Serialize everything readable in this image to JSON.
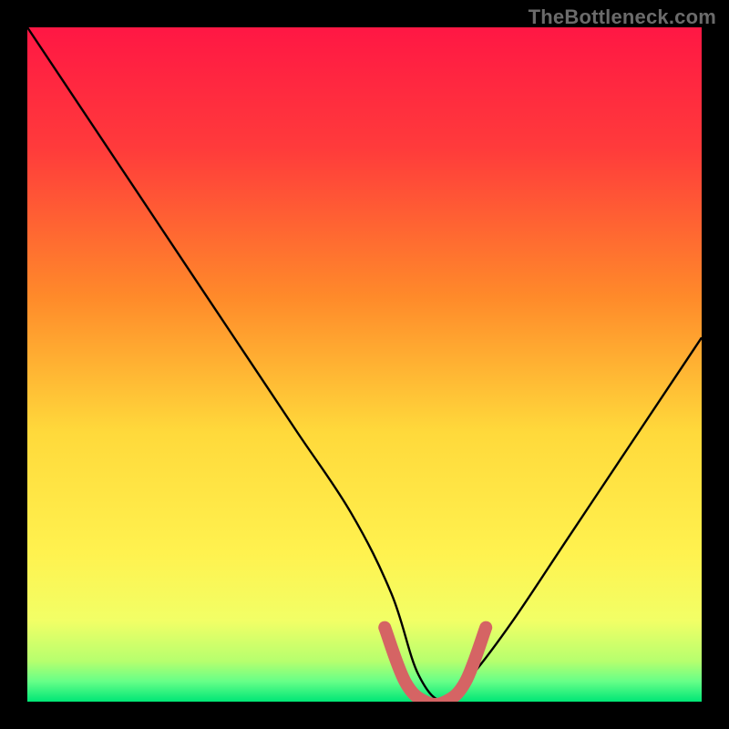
{
  "watermark": "TheBottleneck.com",
  "chart_data": {
    "type": "line",
    "title": "",
    "xlabel": "",
    "ylabel": "",
    "xlim": [
      0,
      100
    ],
    "ylim": [
      0,
      100
    ],
    "grid": false,
    "legend": false,
    "annotations": [],
    "series": [
      {
        "name": "bottleneck-curve",
        "x": [
          0,
          8,
          16,
          24,
          32,
          40,
          48,
          54,
          58,
          62,
          66,
          72,
          80,
          88,
          96,
          100
        ],
        "y": [
          100,
          88,
          76,
          64,
          52,
          40,
          28,
          16,
          4,
          0,
          4,
          12,
          24,
          36,
          48,
          54
        ]
      }
    ],
    "highlight_segment": {
      "name": "valley-highlight",
      "x": [
        53,
        56,
        59,
        62,
        65,
        68
      ],
      "y": [
        11,
        3,
        0,
        0,
        3,
        11
      ]
    },
    "background_gradient": {
      "stops": [
        {
          "offset": 0.0,
          "color": "#ff1744"
        },
        {
          "offset": 0.18,
          "color": "#ff3b3b"
        },
        {
          "offset": 0.4,
          "color": "#ff8a2a"
        },
        {
          "offset": 0.6,
          "color": "#ffd93b"
        },
        {
          "offset": 0.78,
          "color": "#fff24f"
        },
        {
          "offset": 0.88,
          "color": "#f2ff66"
        },
        {
          "offset": 0.94,
          "color": "#b6ff6e"
        },
        {
          "offset": 0.97,
          "color": "#66ff88"
        },
        {
          "offset": 1.0,
          "color": "#00e676"
        }
      ]
    }
  }
}
